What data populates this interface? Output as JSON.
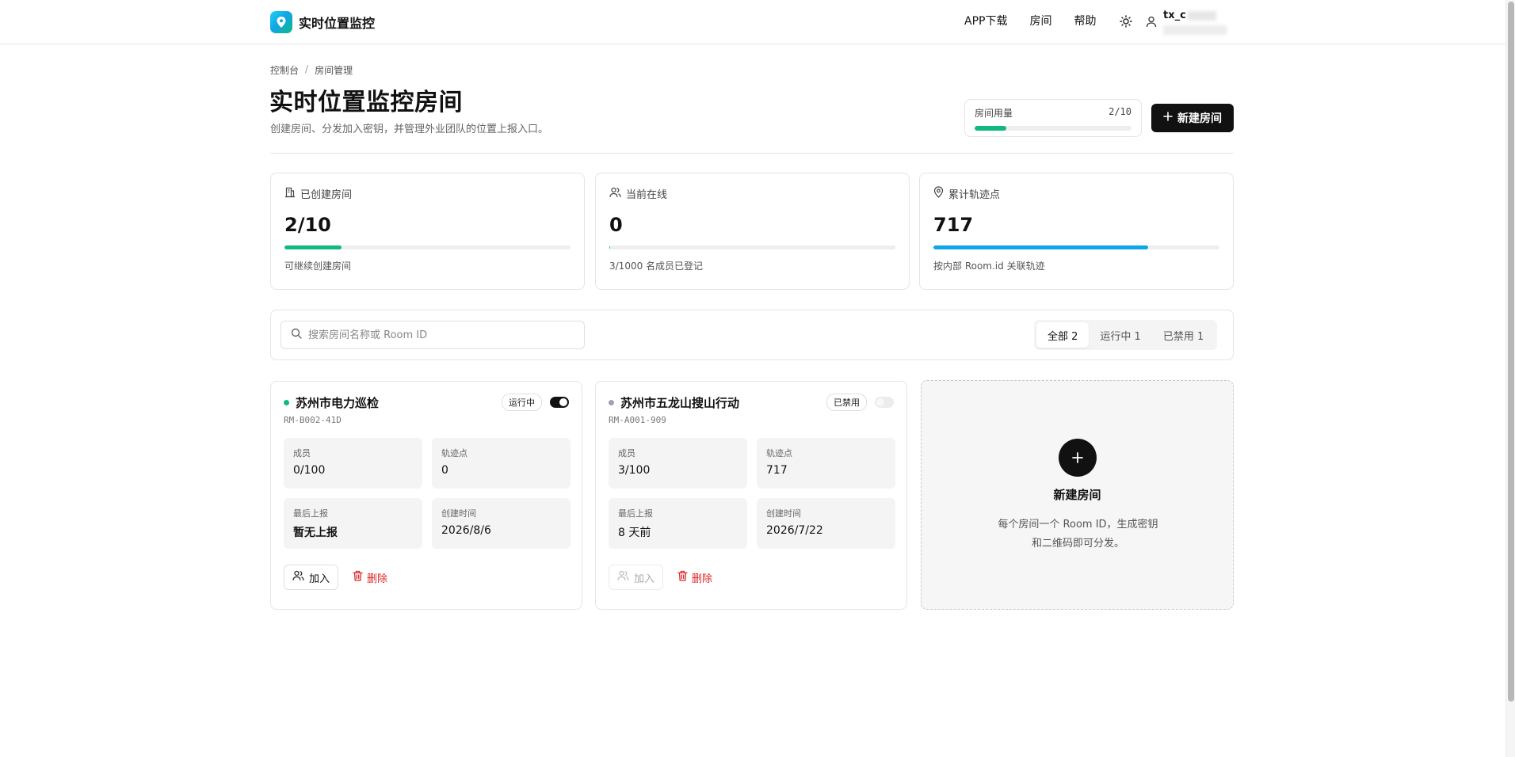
{
  "app": {
    "title": "实时位置监控"
  },
  "nav": {
    "items": [
      "APP下载",
      "房间",
      "帮助"
    ],
    "theme_icon": "sun-icon",
    "user_icon": "user-icon",
    "user_name": "tx_c"
  },
  "breadcrumb": {
    "items": [
      "控制台",
      "房间管理"
    ],
    "separator": "/"
  },
  "header": {
    "title": "实时位置监控房间",
    "subtitle": "创建房间、分发加入密钥，并管理外业团队的位置上报入口。",
    "usage_label": "房间用量",
    "usage_value": "2/10",
    "usage_fraction": 0.2,
    "new_button_label": "新建房间"
  },
  "stats": [
    {
      "icon": "building-icon",
      "label": "已创建房间",
      "value": "2/10",
      "progress": 0.2,
      "color": "#10b981",
      "note": "可继续创建房间"
    },
    {
      "icon": "users-icon",
      "label": "当前在线",
      "value": "0",
      "progress": 0.003,
      "color": "#10b981",
      "note": "3/1000 名成员已登记"
    },
    {
      "icon": "map-pin-icon",
      "label": "累计轨迹点",
      "value": "717",
      "progress": 0.75,
      "color": "#0ea5e9",
      "note": "按内部 Room.id 关联轨迹"
    }
  ],
  "filter": {
    "search_placeholder": "搜索房间名称或 Room ID",
    "search_value": "",
    "segments": [
      "全部 2",
      "运行中 1",
      "已禁用 1"
    ],
    "active_segment": 0
  },
  "rooms": [
    {
      "name": "苏州市电力巡检",
      "room_id": "RM-B002-41D",
      "status": "运行中",
      "status_color": "#10b981",
      "enabled": true,
      "stats": [
        {
          "label": "成员",
          "value": "0/100"
        },
        {
          "label": "轨迹点",
          "value": "0"
        },
        {
          "label": "最后上报",
          "value": "暂无上报"
        },
        {
          "label": "创建时间",
          "value": "2026/8/6"
        }
      ],
      "join_label": "加入",
      "delete_label": "删除"
    },
    {
      "name": "苏州市五龙山搜山行动",
      "room_id": "RM-A001-909",
      "status": "已禁用",
      "status_color": "#9ca3af",
      "enabled": false,
      "stats": [
        {
          "label": "成员",
          "value": "3/100"
        },
        {
          "label": "轨迹点",
          "value": "717"
        },
        {
          "label": "最后上报",
          "value": "8 天前"
        },
        {
          "label": "创建时间",
          "value": "2026/7/22"
        }
      ],
      "join_label": "加入",
      "delete_label": "删除"
    }
  ],
  "new_room_card": {
    "title": "新建房间",
    "desc_line1": "每个房间一个 Room ID，生成密钥",
    "desc_line2": "和二维码即可分发。"
  },
  "colors": {
    "accent_dark": "#111111",
    "success": "#10b981",
    "info": "#0ea5e9",
    "danger": "#dc2626"
  }
}
